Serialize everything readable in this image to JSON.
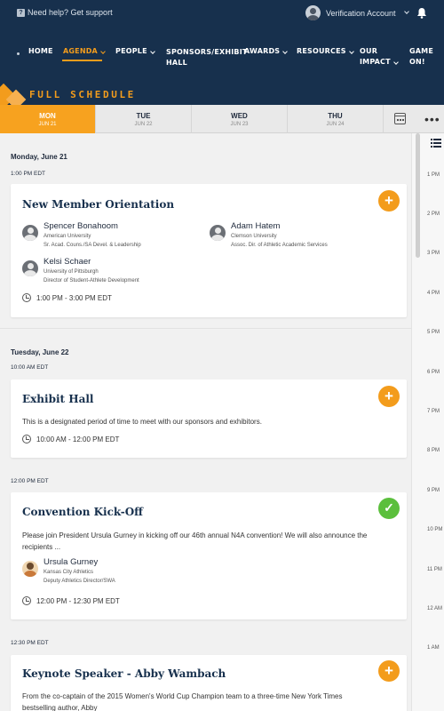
{
  "topbar": {
    "help_label": "Need help? Get support",
    "account_label": "Verification Account"
  },
  "nav": {
    "items": [
      {
        "label": "HOME"
      },
      {
        "label": "AGENDA"
      },
      {
        "label": "PEOPLE"
      },
      {
        "label": "SPONSORS/EXHIBIT",
        "label2": "HALL"
      },
      {
        "label": "AWARDS"
      },
      {
        "label": "RESOURCES"
      },
      {
        "label": "OUR",
        "label2": "IMPACT"
      },
      {
        "label": "GAME",
        "label2": "ON!"
      }
    ],
    "active": "AGENDA"
  },
  "banner_title": "FULL SCHEDULE",
  "days": [
    {
      "name": "MON",
      "date": "JUN 21",
      "active": true
    },
    {
      "name": "TUE",
      "date": "JUN 22",
      "active": false
    },
    {
      "name": "WED",
      "date": "JUN 23",
      "active": false
    },
    {
      "name": "THU",
      "date": "JUN 24",
      "active": false
    }
  ],
  "schedule": {
    "day1_label": "Monday, June 21",
    "day2_label": "Tuesday, June 22",
    "slots": [
      "1:00 PM EDT",
      "10:00 AM EDT",
      "12:00 PM EDT",
      "12:30 PM EDT"
    ],
    "sessions": [
      {
        "title": "New Member Orientation",
        "action": "add",
        "people": [
          {
            "name": "Spencer Bonahoom",
            "org": "American University",
            "role": "Sr. Acad. Couns./SA Devel. & Leadership"
          },
          {
            "name": "Adam Hatem",
            "org": "Clemson University",
            "role": "Assoc. Dir. of Athletic Academic Services"
          },
          {
            "name": "Kelsi Schaer",
            "org": "University of Pittsburgh",
            "role": "Director of Student-Athlete Development"
          }
        ],
        "time": "1:00 PM - 3:00 PM EDT"
      },
      {
        "title": "Exhibit Hall",
        "action": "add",
        "description": "This is a designated period of time to meet with our sponsors and exhibitors.",
        "time": "10:00 AM - 12:00 PM EDT"
      },
      {
        "title": "Convention Kick-Off",
        "action": "added",
        "description1": "Please join President Ursula Gurney in kicking off our 46th annual N4A convention! We will also announce the",
        "description2": "recipients ...",
        "people": [
          {
            "name": "Ursula Gurney",
            "org": "Kansas City Athletics",
            "role": "Deputy Athletics Director/SWA"
          }
        ],
        "time": "12:00 PM - 12:30 PM EDT"
      },
      {
        "title": "Keynote Speaker - Abby Wambach",
        "action": "add",
        "description1": "From the co-captain of the 2015 Women's World Cup Champion team to a three-time New York Times",
        "description2": "bestselling author, Abby"
      }
    ]
  },
  "rail_times": [
    "1 PM",
    "2 PM",
    "3 PM",
    "4 PM",
    "5 PM",
    "6 PM",
    "7 PM",
    "8 PM",
    "9 PM",
    "10 PM",
    "11 PM",
    "12 AM",
    "1 AM"
  ],
  "colors": {
    "navy": "#17304d",
    "orange": "#f39c1c",
    "green": "#5bbf3c"
  }
}
